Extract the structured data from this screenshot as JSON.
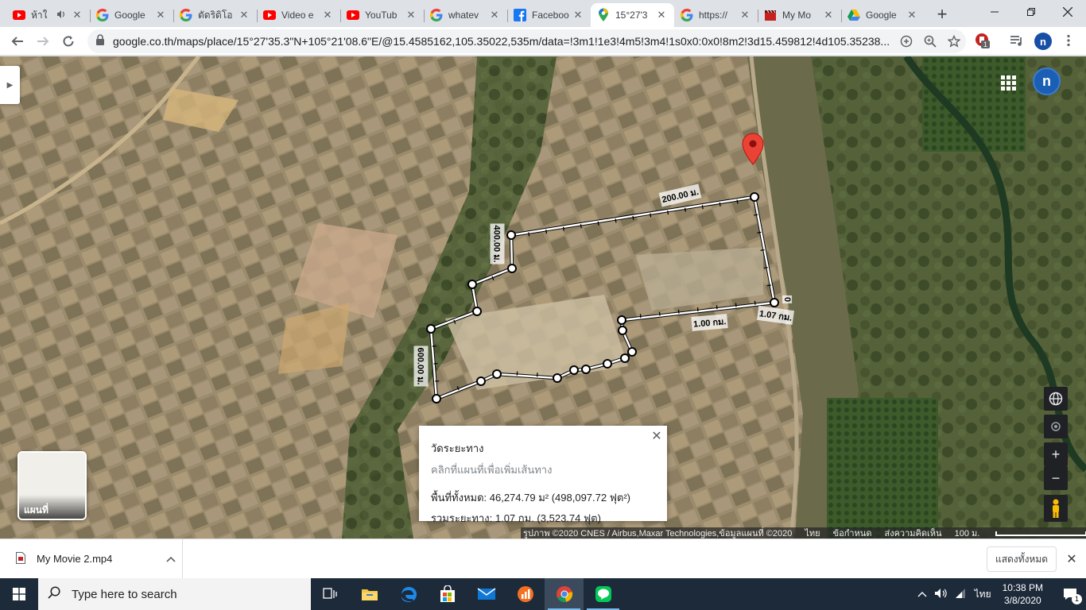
{
  "tabs": [
    {
      "title": "ห้าใ",
      "icon": "youtube-icon",
      "audio": true
    },
    {
      "title": "Google",
      "icon": "google-icon"
    },
    {
      "title": "ตัดริดิโอ",
      "icon": "google-icon"
    },
    {
      "title": "Video e",
      "icon": "youtube-icon"
    },
    {
      "title": "YouTub",
      "icon": "youtube-icon"
    },
    {
      "title": "whatev",
      "icon": "google-icon"
    },
    {
      "title": "Faceboo",
      "icon": "facebook-icon"
    },
    {
      "title": "15°27'3",
      "icon": "maps-pin-icon",
      "active": true
    },
    {
      "title": "https://",
      "icon": "google-icon"
    },
    {
      "title": "My Mo",
      "icon": "clapper-icon"
    },
    {
      "title": "Google",
      "icon": "drive-icon"
    }
  ],
  "toolbar": {
    "url": "google.co.th/maps/place/15°27'35.3\"N+105°21'08.6\"E/@15.4585162,105.35022,535m/data=!3m1!1e3!4m5!3m4!1s0x0:0x0!8m2!3d15.459812!4d105.35238...",
    "extension_badge": "1",
    "profile_initial": "n"
  },
  "map": {
    "profile_initial": "n",
    "distance_labels": {
      "top_edge": "200.00 ม.",
      "left_edge_top": "400.00 ม.",
      "left_edge_bottom": "600.00 ม.",
      "right_end_marker": "0",
      "inner_edge": "1.00 กม.",
      "total_end": "1.07 กม."
    },
    "layer_label": "แผนที่",
    "measure": {
      "title": "วัดระยะทาง",
      "hint": "คลิกที่แผนที่เพื่อเพิ่มเส้นทาง",
      "area": "พื้นที่ทั้งหมด: 46,274.79 ม² (498,097.72 ฟุต²)",
      "distance": "รวมระยะทาง: 1.07 กม. (3,523.74 ฟุต)"
    },
    "attribution": {
      "imagery": "รูปภาพ ©2020 CNES / Airbus,Maxar Technologies,ข้อมูลแผนที่ ©2020",
      "language": "ไทย",
      "terms": "ข้อกำหนด",
      "feedback": "ส่งความคิดเห็น",
      "scale": "100 ม."
    }
  },
  "shelf": {
    "filename": "My Movie 2.mp4",
    "show_all": "แสดงทั้งหมด"
  },
  "taskbar": {
    "search_placeholder": "Type here to search",
    "language": "ไทย",
    "time": "10:38 PM",
    "date": "3/8/2020",
    "notification_count": "1"
  },
  "colors": {
    "measure_line": "#ffffff",
    "pin": "#ea4335",
    "accent": "#1a73e8"
  }
}
